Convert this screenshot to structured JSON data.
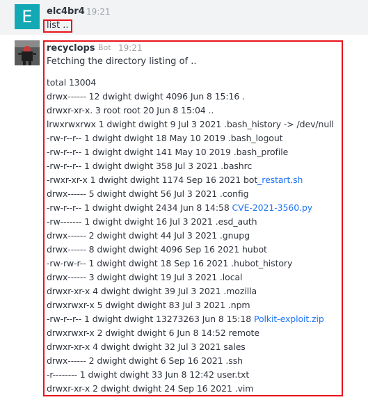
{
  "messages": [
    {
      "avatar_letter": "E",
      "username": "elc4br4",
      "time": "19:21",
      "text": "list .."
    },
    {
      "username": "recyclops",
      "badge": "Bot",
      "time": "19:21",
      "intro": "Fetching the directory listing of ..",
      "lines": [
        {
          "text": "total 13004",
          "link": ""
        },
        {
          "text": "drwx------ 12 dwight dwight 4096 Jun 8 15:16 .",
          "link": ""
        },
        {
          "text": "drwxr-xr-x. 3 root root 20 Jun 8 15:04 ..",
          "link": ""
        },
        {
          "text": "lrwxrwxrwx 1 dwight dwight 9 Jul 3 2021 .bash_history -> /dev/null",
          "link": ""
        },
        {
          "text": "-rw-r--r-- 1 dwight dwight 18 May 10 2019 .bash_logout",
          "link": ""
        },
        {
          "text": "-rw-r--r-- 1 dwight dwight 141 May 10 2019 .bash_profile",
          "link": ""
        },
        {
          "text": "-rw-r--r-- 1 dwight dwight 358 Jul 3 2021 .bashrc",
          "link": ""
        },
        {
          "text": "-rwxr-xr-x 1 dwight dwight 1174 Sep 16 2021 bot",
          "link": "_restart.sh"
        },
        {
          "text": "drwx------ 5 dwight dwight 56 Jul 3 2021 .config",
          "link": ""
        },
        {
          "text": "-rw-r--r-- 1 dwight dwight 2434 Jun 8 14:58 ",
          "link": "CVE-2021-3560.py"
        },
        {
          "text": "-rw------- 1 dwight dwight 16 Jul 3 2021 .esd_auth",
          "link": ""
        },
        {
          "text": "drwx------ 2 dwight dwight 44 Jul 3 2021 .gnupg",
          "link": ""
        },
        {
          "text": "drwx------ 8 dwight dwight 4096 Sep 16 2021 hubot",
          "link": ""
        },
        {
          "text": "-rw-rw-r-- 1 dwight dwight 18 Sep 16 2021 .hubot_history",
          "link": ""
        },
        {
          "text": "drwx------ 3 dwight dwight 19 Jul 3 2021 .local",
          "link": ""
        },
        {
          "text": "drwxr-xr-x 4 dwight dwight 39 Jul 3 2021 .mozilla",
          "link": ""
        },
        {
          "text": "drwxrwxr-x 5 dwight dwight 83 Jul 3 2021 .npm",
          "link": ""
        },
        {
          "text": "-rw-r--r-- 1 dwight dwight 13273263 Jun 8 15:18 ",
          "link": "Polkit-exploit.zip"
        },
        {
          "text": "drwxrwxr-x 2 dwight dwight 6 Jun 8 14:52 remote",
          "link": ""
        },
        {
          "text": "drwxr-xr-x 4 dwight dwight 32 Jul 3 2021 sales",
          "link": ""
        },
        {
          "text": "drwx------ 2 dwight dwight 6 Sep 16 2021 .ssh",
          "link": ""
        },
        {
          "text": "-r-------- 1 dwight dwight 33 Jun 8 12:42 user.txt",
          "link": ""
        },
        {
          "text": "drwxr-xr-x 2 dwight dwight 24 Sep 16 2021 .vim",
          "link": ""
        }
      ]
    }
  ],
  "colors": {
    "avatar_e_bg": "#12a9b5",
    "highlight_border": "#e8131b",
    "link": "#1d74f5",
    "timestamp": "#9ea2a8",
    "highlight_row_bg": "#f2f3f5"
  },
  "icons": {
    "bot_avatar": "robot-avatar-icon"
  }
}
